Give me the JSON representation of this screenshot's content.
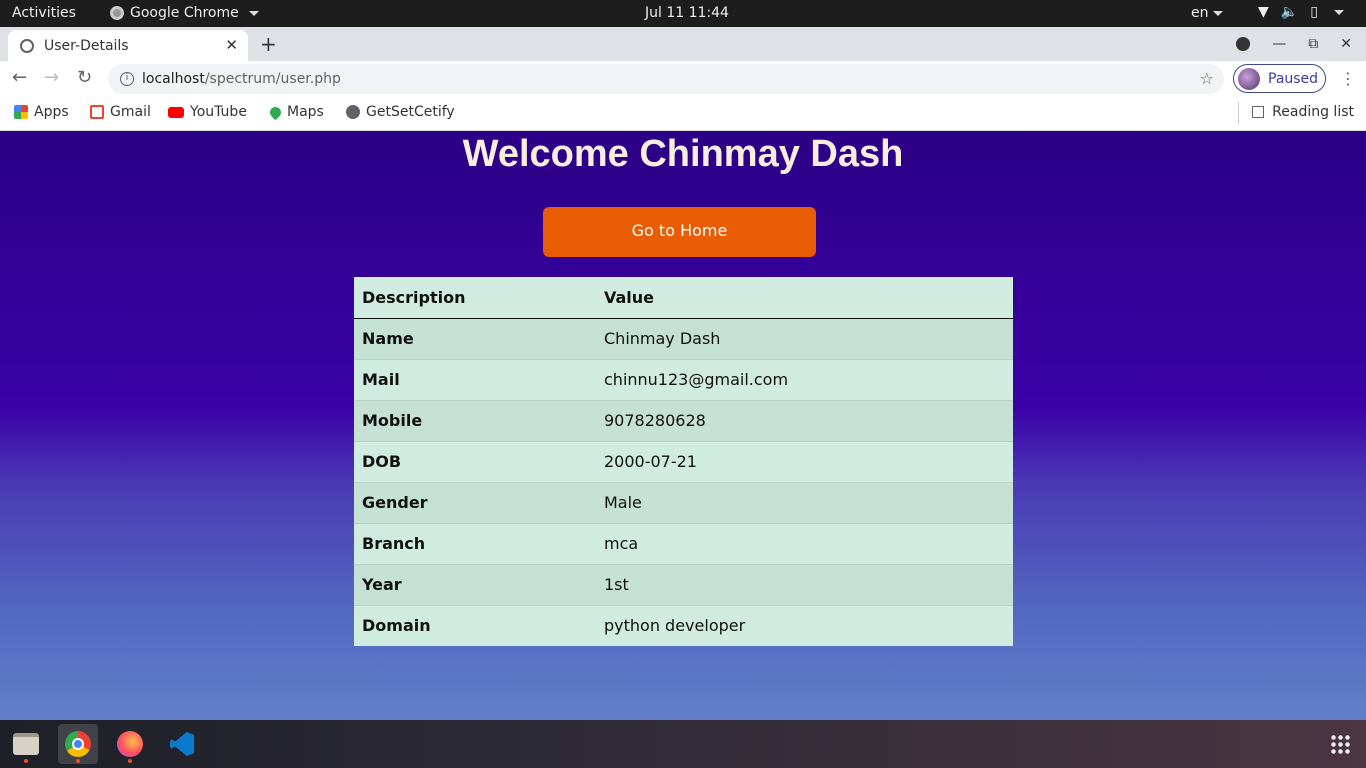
{
  "topbar": {
    "activities": "Activities",
    "app_name": "Google Chrome",
    "clock": "Jul 11  11:44",
    "lang": "en"
  },
  "browser": {
    "tab_title": "User-Details",
    "url_host": "localhost",
    "url_path": "/spectrum/user.php",
    "profile_label": "Paused",
    "bookmarks": [
      "Apps",
      "Gmail",
      "YouTube",
      "Maps",
      "GetSetCetify"
    ],
    "reading_list": "Reading list"
  },
  "page": {
    "welcome": "Welcome Chinmay Dash",
    "home_button": "Go to Home",
    "table": {
      "headers": [
        "Description",
        "Value"
      ],
      "rows": [
        [
          "Name",
          "Chinmay Dash"
        ],
        [
          "Mail",
          "chinnu123@gmail.com"
        ],
        [
          "Mobile",
          "9078280628"
        ],
        [
          "DOB",
          "2000-07-21"
        ],
        [
          "Gender",
          "Male"
        ],
        [
          "Branch",
          "mca"
        ],
        [
          "Year",
          "1st"
        ],
        [
          "Domain",
          "python developer"
        ]
      ]
    }
  },
  "dock": {
    "apps": [
      "files-icon",
      "chrome-icon",
      "firefox-icon",
      "vscode-icon"
    ],
    "accent": "#e95420"
  },
  "colors": {
    "button": "#e85d04",
    "table_row": "#d0ebe0",
    "welcome_text": "#f8eee0"
  }
}
